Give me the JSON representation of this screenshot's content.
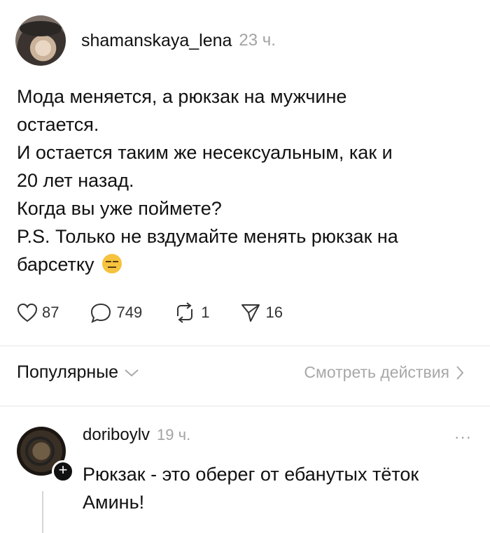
{
  "post": {
    "username": "shamanskaya_lena",
    "time": "23 ч.",
    "lines": [
      "Мода меняется, а рюкзак на мужчине",
      "остается.",
      "И остается таким же несексуальным, как и",
      "20 лет назад.",
      "Когда вы уже поймете?",
      "P.S. Только не вздумайте менять рюкзак на",
      "барсетку"
    ],
    "emoji": "expressionless-face-emoji"
  },
  "actions": {
    "likes": "87",
    "comments": "749",
    "reposts": "1",
    "shares": "16"
  },
  "filter": {
    "sort_label": "Популярные",
    "activity_link": "Смотреть действия"
  },
  "comment": {
    "username": "doriboylv",
    "time": "19 ч.",
    "more": "···",
    "lines": [
      "Рюкзак - это оберег от ебанутых тёток",
      "Аминь!"
    ]
  },
  "colors": {
    "text": "#111111",
    "muted": "#a3a3a3",
    "divider": "#e6e6e6"
  }
}
